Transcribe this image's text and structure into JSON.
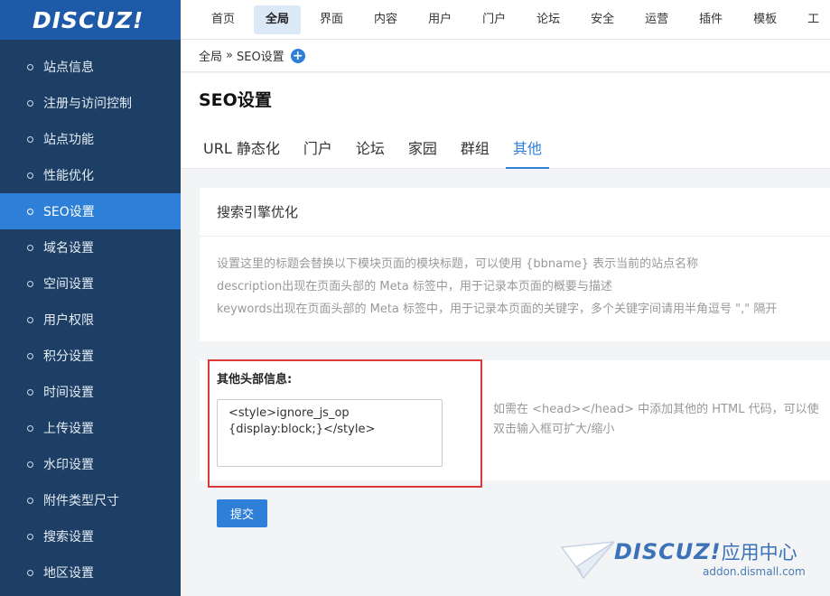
{
  "brand": {
    "logo_text": "DISCUZ!"
  },
  "sidebar": {
    "items": [
      {
        "label": "站点信息"
      },
      {
        "label": "注册与访问控制"
      },
      {
        "label": "站点功能"
      },
      {
        "label": "性能优化"
      },
      {
        "label": "SEO设置",
        "active": true
      },
      {
        "label": "域名设置"
      },
      {
        "label": "空间设置"
      },
      {
        "label": "用户权限"
      },
      {
        "label": "积分设置"
      },
      {
        "label": "时间设置"
      },
      {
        "label": "上传设置"
      },
      {
        "label": "水印设置"
      },
      {
        "label": "附件类型尺寸"
      },
      {
        "label": "搜索设置"
      },
      {
        "label": "地区设置"
      }
    ]
  },
  "topnav": {
    "items": [
      {
        "label": "首页"
      },
      {
        "label": "全局",
        "active": true
      },
      {
        "label": "界面"
      },
      {
        "label": "内容"
      },
      {
        "label": "用户"
      },
      {
        "label": "门户"
      },
      {
        "label": "论坛"
      },
      {
        "label": "安全"
      },
      {
        "label": "运营"
      },
      {
        "label": "插件"
      },
      {
        "label": "模板"
      },
      {
        "label": "工"
      }
    ]
  },
  "breadcrumb": {
    "root": "全局",
    "separator": "»",
    "current": "SEO设置",
    "add_symbol": "+"
  },
  "page": {
    "title": "SEO设置"
  },
  "tabs": [
    {
      "label": "URL 静态化"
    },
    {
      "label": "门户"
    },
    {
      "label": "论坛"
    },
    {
      "label": "家园"
    },
    {
      "label": "群组"
    },
    {
      "label": "其他",
      "active": true
    }
  ],
  "seo_panel": {
    "title": "搜索引擎优化",
    "lines": [
      "设置这里的标题会替换以下模块页面的模块标题，可以使用 {bbname} 表示当前的站点名称",
      "description出现在页面头部的 Meta 标签中，用于记录本页面的概要与描述",
      "keywords出现在页面头部的 Meta 标签中，用于记录本页面的关键字，多个关键字间请用半角逗号 \",\" 隔开"
    ]
  },
  "head_field": {
    "label": "其他头部信息:",
    "value": "<style>ignore_js_op {display:block;}</style>",
    "hint_lines": [
      "如需在 <head></head> 中添加其他的 HTML 代码，可以使",
      "双击输入框可扩大/缩小"
    ]
  },
  "submit": {
    "label": "提交"
  },
  "watermark": {
    "title": "DISCUZ!",
    "title_cn": "应用中心",
    "url": "addon.dismall.com"
  },
  "colors": {
    "sidebar_bg": "#1d3f66",
    "accent": "#2d7fd8",
    "highlight": "#dc3a3a"
  }
}
